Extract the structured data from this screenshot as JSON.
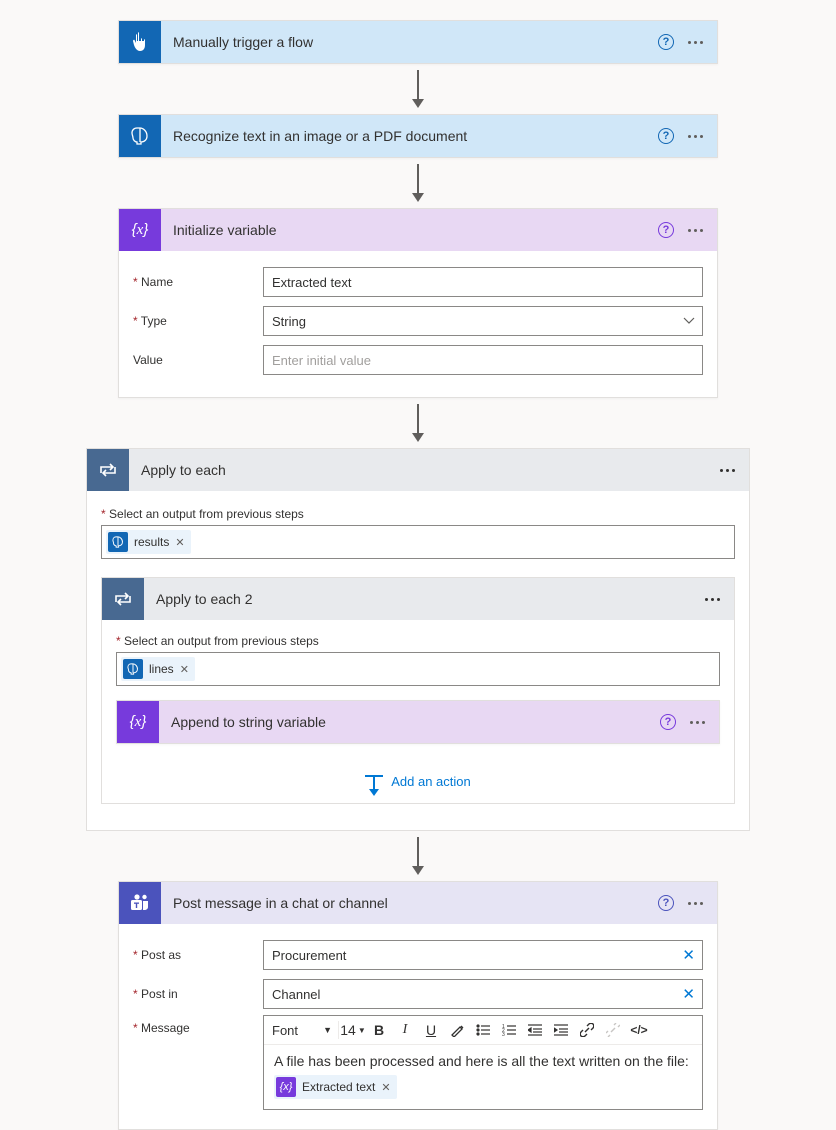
{
  "step1": {
    "title": "Manually trigger a flow"
  },
  "step2": {
    "title": "Recognize text in an image or a PDF document"
  },
  "step3": {
    "title": "Initialize variable",
    "fields": {
      "name_label": "Name",
      "name_value": "Extracted text",
      "type_label": "Type",
      "type_value": "String",
      "value_label": "Value",
      "value_placeholder": "Enter initial value"
    }
  },
  "scope1": {
    "title": "Apply to each",
    "select_label": "Select an output from previous steps",
    "token": "results"
  },
  "scope2": {
    "title": "Apply to each 2",
    "select_label": "Select an output from previous steps",
    "token": "lines"
  },
  "append": {
    "title": "Append to string variable"
  },
  "add_action": "Add an action",
  "teams": {
    "title": "Post message in a chat or channel",
    "postas_label": "Post as",
    "postas_value": "Procurement",
    "postin_label": "Post in",
    "postin_value": "Channel",
    "message_label": "Message",
    "font_label": "Font",
    "font_size": "14",
    "body_text": "A file has been processed and here is all the text written on the file:",
    "token": "Extracted text"
  }
}
